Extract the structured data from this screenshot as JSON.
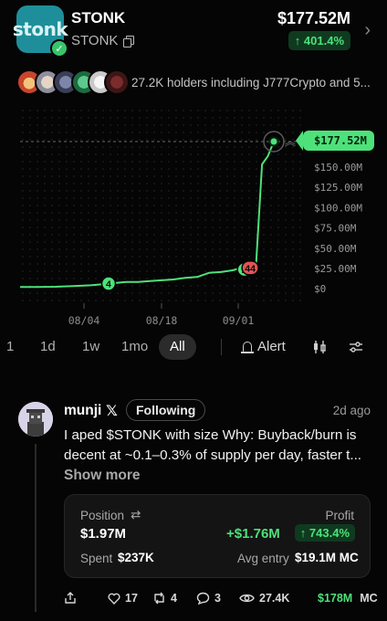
{
  "token": {
    "logo_text": "stonk",
    "name": "STONK",
    "ticker": "STONK",
    "market_cap": "$177.52M",
    "change_pct": "↑ 401.4%"
  },
  "holders": {
    "text": "27.2K holders including J777Crypto and 5..."
  },
  "chart_data": {
    "type": "line",
    "x_tick_labels": [
      "08/04",
      "08/18",
      "09/01"
    ],
    "y_tick_labels": [
      "$150.00M",
      "$125.00M",
      "$100.00M",
      "$75.00M",
      "$50.00M",
      "$25.00M",
      "$0"
    ],
    "ylim": [
      0,
      177.52
    ],
    "current_price_label": "$177.52M",
    "x": [
      0,
      3,
      6,
      9,
      12,
      15,
      18,
      20,
      22,
      24,
      26,
      28,
      30,
      32,
      34,
      36,
      37,
      38,
      39,
      40,
      41,
      42,
      43
    ],
    "values": [
      2,
      2,
      2.2,
      3,
      4,
      6,
      8,
      8,
      9,
      10,
      11,
      13,
      14,
      19,
      20,
      22,
      24,
      23,
      25,
      30,
      150,
      160,
      177.52
    ],
    "markers": [
      {
        "label": "4",
        "x": 15,
        "y": 6,
        "color": "#4ee17a"
      },
      {
        "label": "2",
        "x": 38,
        "y": 23,
        "color": "#4ee17a"
      },
      {
        "label": "44",
        "x": 39,
        "y": 25,
        "color": "#e05555"
      }
    ],
    "grid": true
  },
  "timeframes": {
    "partial": "1",
    "items": [
      "1d",
      "1w",
      "1mo",
      "All"
    ],
    "active": "All",
    "alert_label": "Alert"
  },
  "post": {
    "username": "munji",
    "x_glyph": "𝕏",
    "following_label": "Following",
    "time": "2d ago",
    "lines": [
      "I aped $STONK with size Why: Buyback/burn is",
      "decent at ~0.1–0.3% of supply per day, faster t..."
    ],
    "show_more": "Show more",
    "position": {
      "position_label": "Position",
      "swap_glyph": "⇄",
      "position_value": "$1.97M",
      "profit_label": "Profit",
      "profit_value": "+$1.76M",
      "profit_pct": "↑ 743.4%",
      "spent_label": "Spent",
      "spent_value": "$237K",
      "avg_entry_label": "Avg entry",
      "avg_entry_value": "$19.1M MC"
    },
    "actions": {
      "likes": "17",
      "reposts": "4",
      "replies": "3",
      "views": "27.4K",
      "mc_value": "$178M",
      "mc_label": "MC"
    }
  },
  "colors": {
    "accent": "#4ee17a",
    "negative": "#e05555",
    "background": "#050505"
  }
}
